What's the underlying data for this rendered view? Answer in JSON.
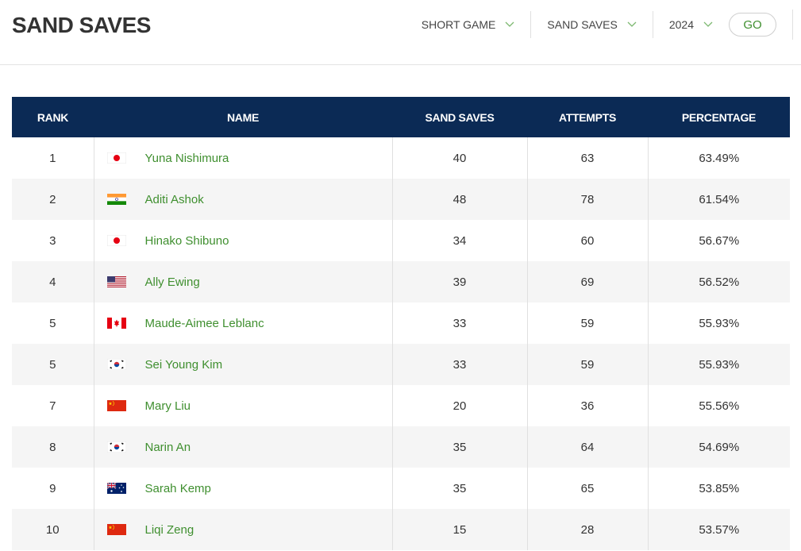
{
  "header": {
    "title": "SAND SAVES",
    "filters": [
      {
        "label": "SHORT GAME",
        "icon": "chevron-down-icon"
      },
      {
        "label": "SAND SAVES",
        "icon": "chevron-down-icon"
      },
      {
        "label": "2024",
        "icon": "chevron-down-icon"
      }
    ],
    "go_label": "GO"
  },
  "colors": {
    "header_bg": "#0b2a55",
    "link_green": "#3f8f2f",
    "row_alt": "#f5f5f5"
  },
  "table": {
    "columns": [
      "RANK",
      "NAME",
      "SAND SAVES",
      "ATTEMPTS",
      "PERCENTAGE"
    ],
    "rows": [
      {
        "rank": "1",
        "flag": "japan",
        "name": "Yuna Nishimura",
        "saves": "40",
        "attempts": "63",
        "pct": "63.49%"
      },
      {
        "rank": "2",
        "flag": "india",
        "name": "Aditi Ashok",
        "saves": "48",
        "attempts": "78",
        "pct": "61.54%"
      },
      {
        "rank": "3",
        "flag": "japan",
        "name": "Hinako Shibuno",
        "saves": "34",
        "attempts": "60",
        "pct": "56.67%"
      },
      {
        "rank": "4",
        "flag": "usa",
        "name": "Ally Ewing",
        "saves": "39",
        "attempts": "69",
        "pct": "56.52%"
      },
      {
        "rank": "5",
        "flag": "canada",
        "name": "Maude-Aimee Leblanc",
        "saves": "33",
        "attempts": "59",
        "pct": "55.93%"
      },
      {
        "rank": "5",
        "flag": "korea",
        "name": "Sei Young Kim",
        "saves": "33",
        "attempts": "59",
        "pct": "55.93%"
      },
      {
        "rank": "7",
        "flag": "china",
        "name": "Mary Liu",
        "saves": "20",
        "attempts": "36",
        "pct": "55.56%"
      },
      {
        "rank": "8",
        "flag": "korea",
        "name": "Narin An",
        "saves": "35",
        "attempts": "64",
        "pct": "54.69%"
      },
      {
        "rank": "9",
        "flag": "australia",
        "name": "Sarah Kemp",
        "saves": "35",
        "attempts": "65",
        "pct": "53.85%"
      },
      {
        "rank": "10",
        "flag": "china",
        "name": "Liqi Zeng",
        "saves": "15",
        "attempts": "28",
        "pct": "53.57%"
      }
    ]
  }
}
